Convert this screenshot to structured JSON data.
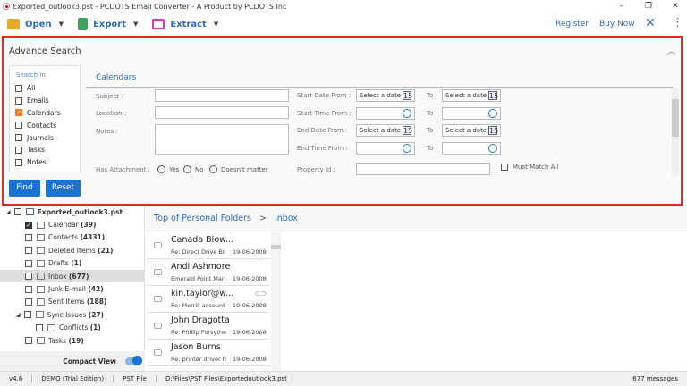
{
  "window": {
    "title": "Exported_outlook3.pst - PCDOTS Email Converter - A Product by PCDOTS Inc",
    "minimize": "–",
    "restore": "❐",
    "close": "✕"
  },
  "toolbar": {
    "open": "Open",
    "export": "Export",
    "extract": "Extract",
    "register": "Register",
    "buy_now": "Buy Now",
    "close": "✕",
    "more": "⋮"
  },
  "advance_search": {
    "title": "Advance Search",
    "collapse": "︿",
    "search_in": {
      "header": "Search In",
      "items": [
        {
          "label": "All",
          "checked": false
        },
        {
          "label": "Emails",
          "checked": false
        },
        {
          "label": "Calendars",
          "checked": true
        },
        {
          "label": "Contacts",
          "checked": false
        },
        {
          "label": "Journals",
          "checked": false
        },
        {
          "label": "Tasks",
          "checked": false
        },
        {
          "label": "Notes",
          "checked": false
        }
      ]
    },
    "find": "Find",
    "reset": "Reset",
    "section": "Calendars",
    "subject": "Subject :",
    "location": "Location :",
    "notes": "Notes :",
    "has_attachment": "Has Attachment :",
    "yes": "Yes",
    "no": "No",
    "doesnt_matter": "Doesn't matter",
    "start_date_from": "Start Date From :",
    "start_time_from": "Start Time From :",
    "end_date_from": "End Date From :",
    "end_time_from": "End Time From :",
    "to": "To",
    "date_placeholder": "Select a date",
    "date_icon_text": "15",
    "property_id": "Property Id :",
    "must_match_all": "Must Match All"
  },
  "tree": {
    "root": "Exported_outlook3.pst",
    "items": [
      {
        "label": "Calendar",
        "count": "(39)",
        "checked": true,
        "indent": 1
      },
      {
        "label": "Contacts",
        "count": "(4331)",
        "indent": 1
      },
      {
        "label": "Deleted Items",
        "count": "(21)",
        "indent": 1
      },
      {
        "label": "Drafts",
        "count": "(1)",
        "indent": 1
      },
      {
        "label": "Inbox",
        "count": "(677)",
        "indent": 1,
        "selected": true
      },
      {
        "label": "Junk E-mail",
        "count": "(42)",
        "indent": 1
      },
      {
        "label": "Sent Items",
        "count": "(188)",
        "indent": 1
      },
      {
        "label": "Sync Issues",
        "count": "(27)",
        "indent": 1,
        "expanded": true
      },
      {
        "label": "Conflicts",
        "count": "(1)",
        "indent": 2
      },
      {
        "label": "Tasks",
        "count": "(19)",
        "indent": 1
      }
    ],
    "compact_view": "Compact View",
    "compact_on": true
  },
  "breadcrumb": {
    "root": "Top of Personal Folders",
    "sep": ">",
    "current": "Inbox"
  },
  "mails": [
    {
      "from": "Canada Blow...",
      "subject": "Re: Direct Drive BI F",
      "date": "19-06-2008"
    },
    {
      "from": "Andi Ashmore",
      "subject": "Emerald Point Marir",
      "date": "19-06-2008"
    },
    {
      "from": "kin.taylor@w...",
      "subject": "Re: Merrill account",
      "date": "19-06-2008",
      "attachment": true
    },
    {
      "from": "John Dragotta",
      "subject": "Re: Phillip Forsythe",
      "date": "19-06-2008"
    },
    {
      "from": "Jason Burns",
      "subject": "Re: printer driver for",
      "date": "19-06-2008"
    }
  ],
  "status": {
    "version": "v4.6",
    "edition": "DEMO (Trial Edition)",
    "type": "PST File",
    "path": "D:\\Files\\PST Files\\Exportedoutlook3.pst",
    "count": "677 messages"
  },
  "colors": {
    "accent": "#1a73d1",
    "highlight": "#e8261c",
    "checked": "#f47b20"
  }
}
